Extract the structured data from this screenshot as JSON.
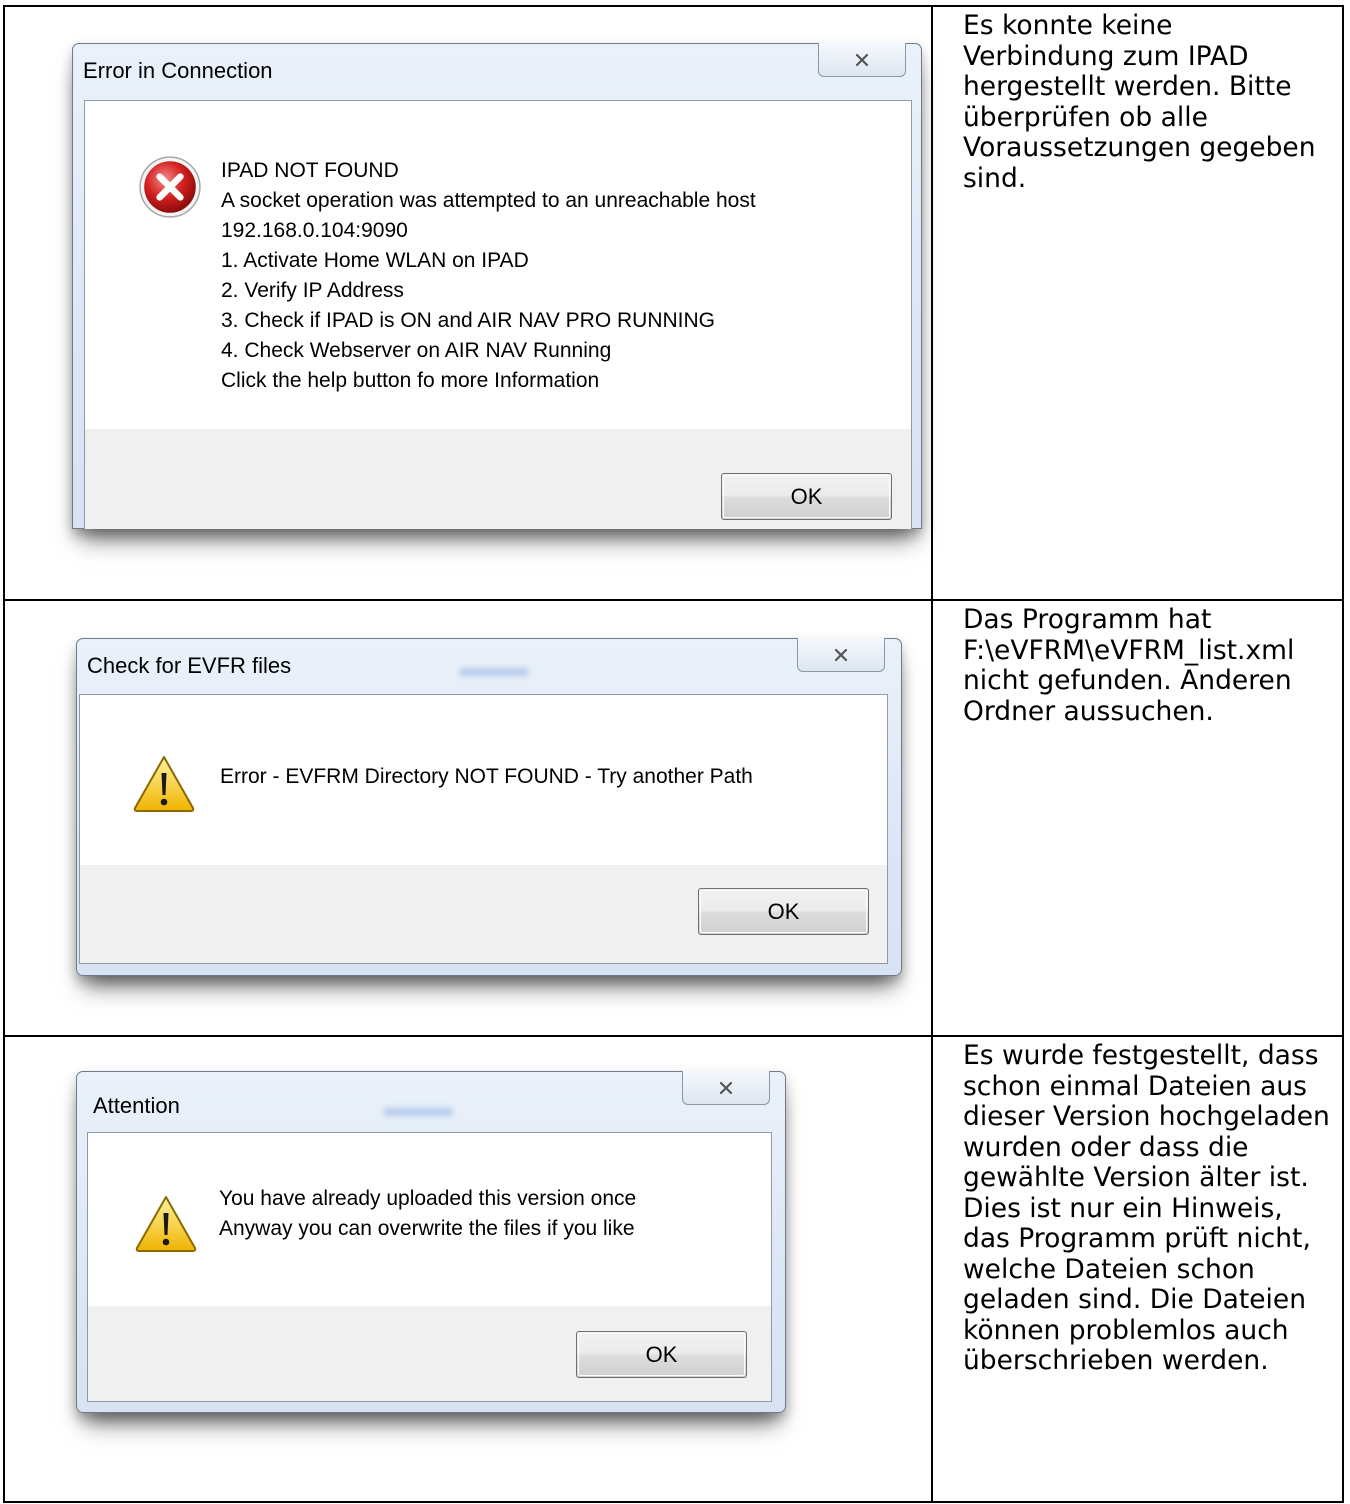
{
  "rows": [
    {
      "dialog": {
        "title": "Error in Connection",
        "icon": "error-icon",
        "message": "IPAD NOT FOUND\nA socket operation was attempted to an unreachable host\n192.168.0.104:9090\n1. Activate Home WLAN on IPAD\n2. Verify IP Address\n3. Check if IPAD is ON and AIR NAV PRO RUNNING\n4. Check Webserver on AIR NAV Running\nClick the help button fo more Information",
        "ok_label": "OK"
      },
      "note": "Es konnte keine Verbindung zum IPAD hergestellt werden. Bitte überprüfen ob alle Voraussetzungen gegeben sind."
    },
    {
      "dialog": {
        "title": "Check for EVFR files",
        "icon": "warning-icon",
        "message": "Error - EVFRM Directory NOT FOUND - Try another Path",
        "ok_label": "OK"
      },
      "note": "Das Programm hat F:\\eVFRM\\eVFRM_list.xml nicht gefunden. Anderen Ordner aussuchen."
    },
    {
      "dialog": {
        "title": "Attention",
        "icon": "warning-icon",
        "message": "You have already uploaded this version once\nAnyway you can overwrite the files if you like",
        "ok_label": "OK"
      },
      "note": "Es wurde festgestellt, dass schon einmal Dateien aus dieser Version hochgeladen wurden oder dass die gewählte Version älter ist.\nDies ist nur ein Hinweis, das Programm prüft nicht, welche Dateien schon geladen sind. Die Dateien können problemlos auch überschrieben werden."
    }
  ]
}
